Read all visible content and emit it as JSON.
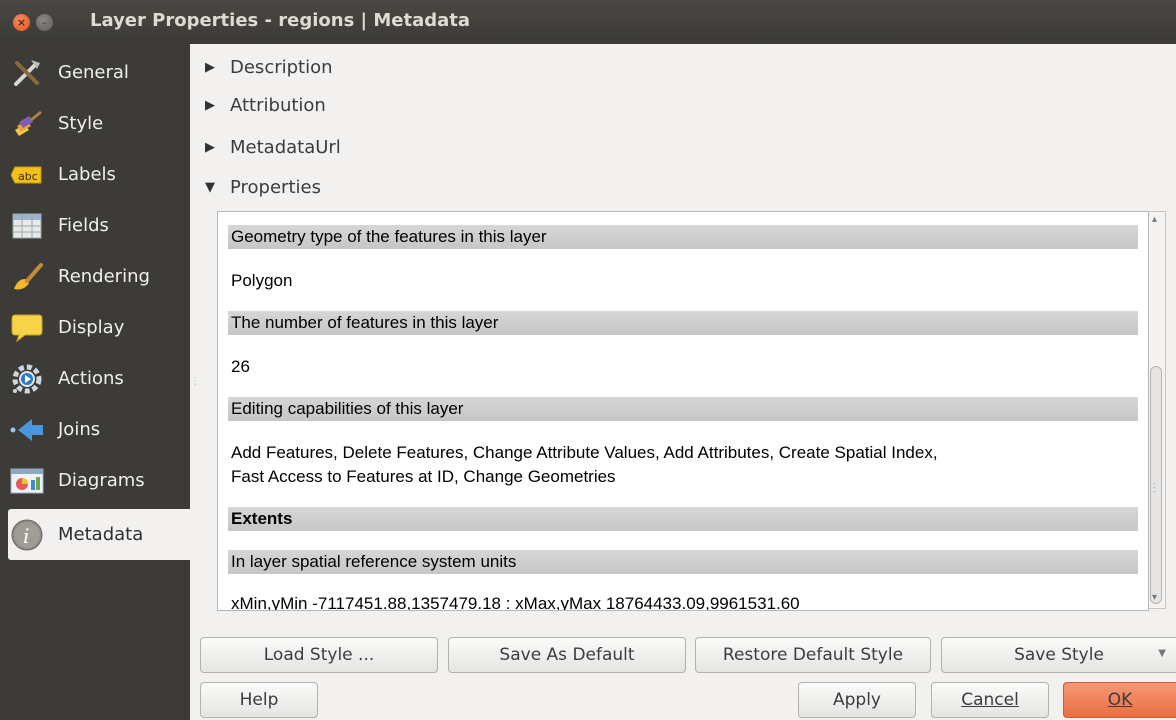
{
  "window": {
    "title": "Layer Properties - regions | Metadata",
    "close_glyph": "×",
    "min_glyph": "–"
  },
  "sidebar": {
    "items": [
      {
        "label": "General",
        "icon": "tools-icon"
      },
      {
        "label": "Style",
        "icon": "paintbrush-icon"
      },
      {
        "label": "Labels",
        "icon": "abc-label-icon"
      },
      {
        "label": "Fields",
        "icon": "table-icon"
      },
      {
        "label": "Rendering",
        "icon": "brush-icon"
      },
      {
        "label": "Display",
        "icon": "speech-bubble-icon"
      },
      {
        "label": "Actions",
        "icon": "gear-play-icon"
      },
      {
        "label": "Joins",
        "icon": "join-arrow-icon"
      },
      {
        "label": "Diagrams",
        "icon": "chart-icon"
      },
      {
        "label": "Metadata",
        "icon": "info-icon",
        "active": true
      }
    ],
    "abc_text": "abc",
    "info_text": "i"
  },
  "tree": {
    "items": [
      {
        "label": "Description",
        "expanded": false
      },
      {
        "label": "Attribution",
        "expanded": false
      },
      {
        "label": "MetadataUrl",
        "expanded": false
      },
      {
        "label": "Properties",
        "expanded": true
      }
    ],
    "collapsed_glyph": "▶",
    "expanded_glyph": "▼"
  },
  "properties": {
    "geometry_header": "Geometry type of the features in this layer",
    "geometry_value": "Polygon",
    "count_header": "The number of features in this layer",
    "count_value": "26",
    "editing_header": "Editing capabilities of this layer",
    "editing_value_line1": "Add Features, Delete Features, Change Attribute Values, Add Attributes, Create Spatial Index,",
    "editing_value_line2": "Fast Access to Features at ID, Change Geometries",
    "extents_header": "Extents",
    "units_header": "In layer spatial reference system units",
    "extent_value": "xMin,yMin -7117451.88,1357479.18 : xMax,yMax 18764433.09,9961531.60"
  },
  "buttons": {
    "load_style": "Load Style ...",
    "save_as_default": "Save As Default",
    "restore_default": "Restore Default Style",
    "save_style": "Save Style",
    "help": "Help",
    "apply": "Apply",
    "cancel": "Cancel",
    "ok": "OK"
  },
  "colors": {
    "sidebar_bg": "#3c3b37",
    "ok_accent": "#ea6f43",
    "close_button": "#e0531e"
  }
}
